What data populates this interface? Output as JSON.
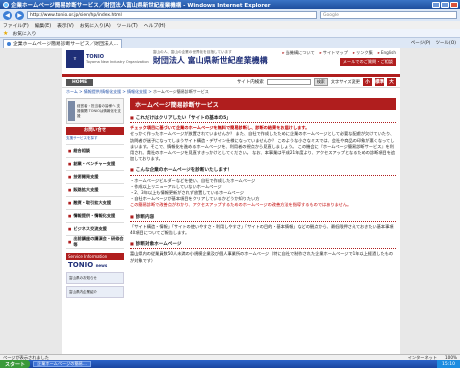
{
  "window": {
    "title": "企業ホームページ簡易診断サービス／財団法人富山県新世紀産業機構 - Windows Internet Explorer"
  },
  "browser": {
    "url": "http://www.tonio.or.jp/sien/hp/index.html",
    "search_placeholder": "Google",
    "menu": [
      "ファイル(F)",
      "編集(E)",
      "表示(V)",
      "お気に入り(A)",
      "ツール(T)",
      "ヘルプ(H)"
    ],
    "fav_label": "お気に入り",
    "tab_label": "企業ホームページ簡易診断サービス／財団法人…",
    "tools": [
      "ページ(P)",
      "ツール(O)"
    ]
  },
  "site": {
    "logo": "TONIO",
    "logo_sub": "Toyama New Industry Organization",
    "org_tagline": "富山の人、富山の企業の世界化を目指しています",
    "org_name": "財団法人 富山県新世紀産業機構",
    "util_links": [
      "当機構について",
      "サイトマップ",
      "リンク集",
      "English"
    ],
    "mail_label": "メールでのご質問・ご相談",
    "home_label": "HOME",
    "search_label": "サイト内検索",
    "search_button": "検索",
    "fontsize_label": "文字サイズ変更",
    "font_buttons": [
      "小",
      "標準",
      "大"
    ]
  },
  "breadcrumb": {
    "links": [
      "ホーム",
      "情報提供/情報化支援",
      "情報化支援"
    ],
    "current": "ホームページ簡易診断サービス"
  },
  "sidebar": {
    "image_text": "経営者・担当者の皆様へ 支援機関 TONIOは情報化を支援",
    "contact_button": "お問い合せ",
    "top_link": "支援サービスを探す",
    "items": [
      "総合相談",
      "創業・ベンチャー支援",
      "技術開発支援",
      "販路拡大支援",
      "融資・取引拡大支援",
      "情報提供・情報化支援",
      "ビジネス交流支援",
      "出前講座の講演会・研修会等"
    ],
    "info_header": "Service Information",
    "info_brand": "TONIO",
    "info_brand2": "news",
    "banners": [
      "富山県のお知らせ",
      "富山県内企業紹介"
    ]
  },
  "main": {
    "title": "ホームページ簡易診断サービス",
    "s1_head": "これだけはクリアしたい「サイトの基本の5」",
    "s1_lead": "チェック項目に基づいて企業のホームページを無料で簡易診断し、診断の結果をお届けします。",
    "s1_body": "せっかく作ったホームページが放置されていませんか？ また、自社で作成したために企業のホームページとして必要な配慮が欠けていたり、訪問者が迷子になってしまうサイト構造・デザイン仕様になっていませんか？ このような小さなミスでは、会社や商品の印象が悪くなってしまいます。そこで、情報化を進めるホームページを、利用者の視点から見直しましょう。 この機会に『ホームページ簡易診断サービス』を利用され、貴社のホームページを見直すきっかけとしてください。 なお、本事業は平成21年度より、アクセスアップとなるための診断項目を追加しております。",
    "s2_head": "こんな企業のホームページを診断いたします！",
    "s2_items": [
      "ホームページビルダーなどを使い、自社で作成したホームページ",
      "作成以上リニューアルしていないホームページ",
      "2、3年以上も情報更新がされず放置しているホームページ",
      "自社ホームページが基本項目をクリアしているかどうか知りたい方"
    ],
    "s2_note": "この簡易診断で改善点がわかり、アクセスアップするためのホームページの改善方法を指導するものではありません。",
    "s3_head": "診断内容",
    "s3_body": "「サイト構造・情報」「サイトの使いやすさ・利用しやすさ」「サイトの目的・基本情報」などの観点から、最低限押さえておきたい基本事項40項目についてご報告します。",
    "s4_head": "診断対象ホームページ",
    "s4_body": "富山県内の従業員数50人未満の小規模企業及び個人事業所のホームページ（特に自社で制作された企業ホームページで1年以上経過したものが対象です）"
  },
  "status": {
    "text": "ページが表示されました",
    "zone": "インターネット",
    "zoom": "100%"
  },
  "taskbar": {
    "start": "スタート",
    "task": "企業ホームページの簡易...",
    "clock": "15:10"
  }
}
